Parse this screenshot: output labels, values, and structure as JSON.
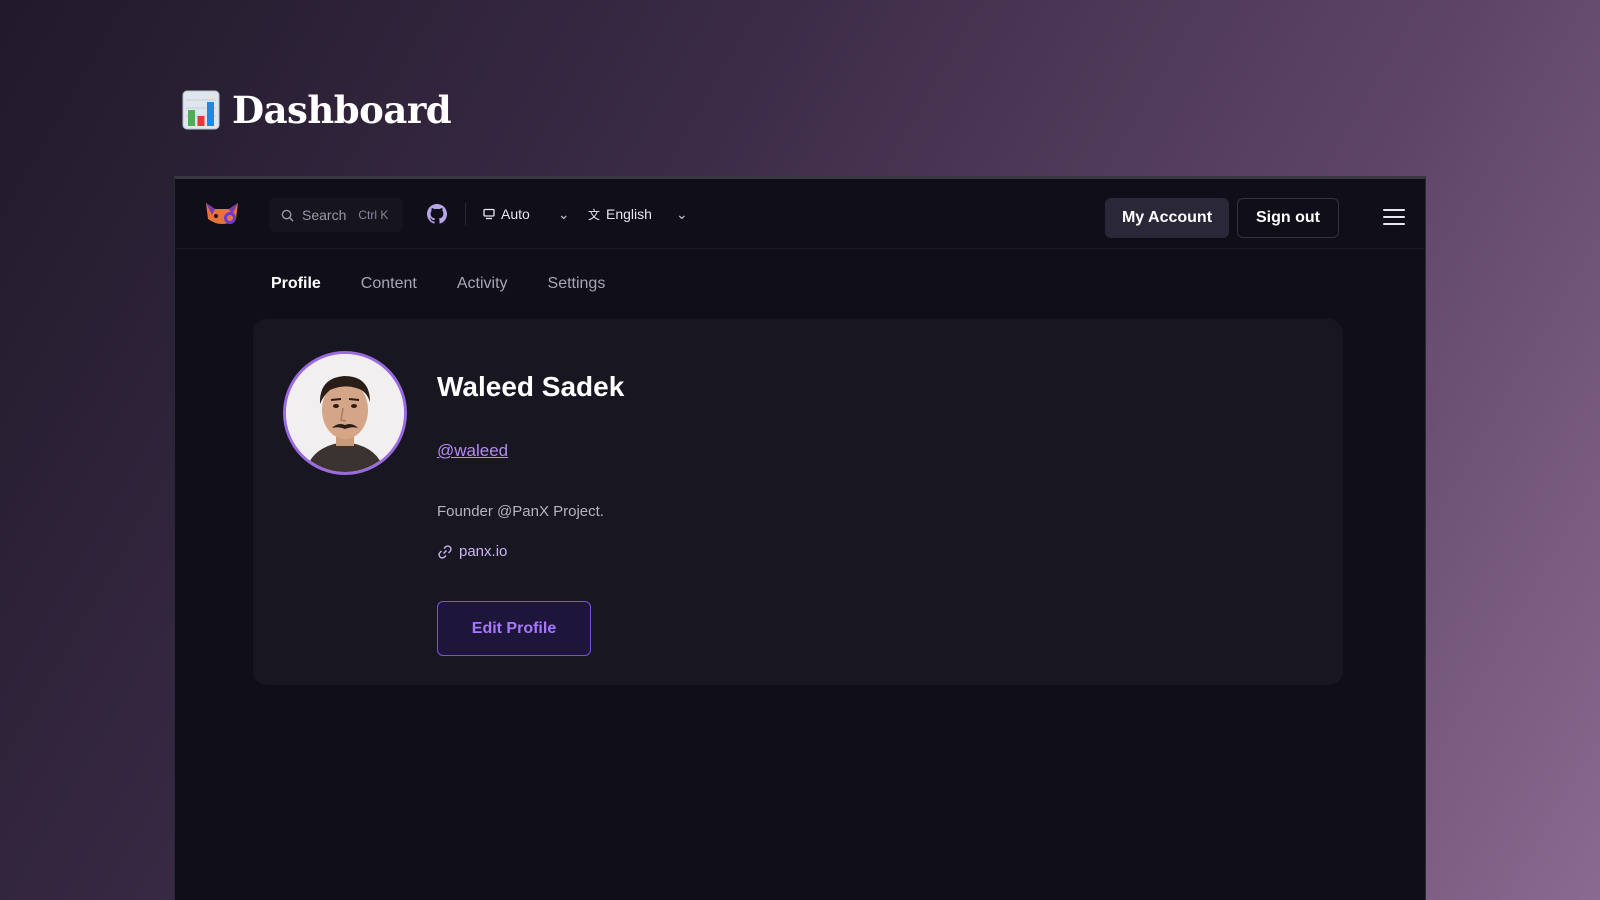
{
  "page": {
    "title": "Dashboard",
    "heading_icon": "bar-chart-icon"
  },
  "topbar": {
    "search": {
      "label": "Search",
      "shortcut": "Ctrl K"
    },
    "theme": {
      "label": "Auto",
      "icon": "monitor-icon"
    },
    "language": {
      "label": "English",
      "icon": "translate-icon"
    },
    "account_label": "My Account",
    "signout_label": "Sign out"
  },
  "tabs": [
    {
      "label": "Profile",
      "active": true
    },
    {
      "label": "Content",
      "active": false
    },
    {
      "label": "Activity",
      "active": false
    },
    {
      "label": "Settings",
      "active": false
    }
  ],
  "profile": {
    "name": "Waleed Sadek",
    "handle": "@waleed",
    "bio": "Founder @PanX Project.",
    "website": "panx.io",
    "edit_label": "Edit Profile"
  },
  "colors": {
    "accent": "#a877ff",
    "window_bg": "#100e18",
    "card_bg": "#181621"
  }
}
